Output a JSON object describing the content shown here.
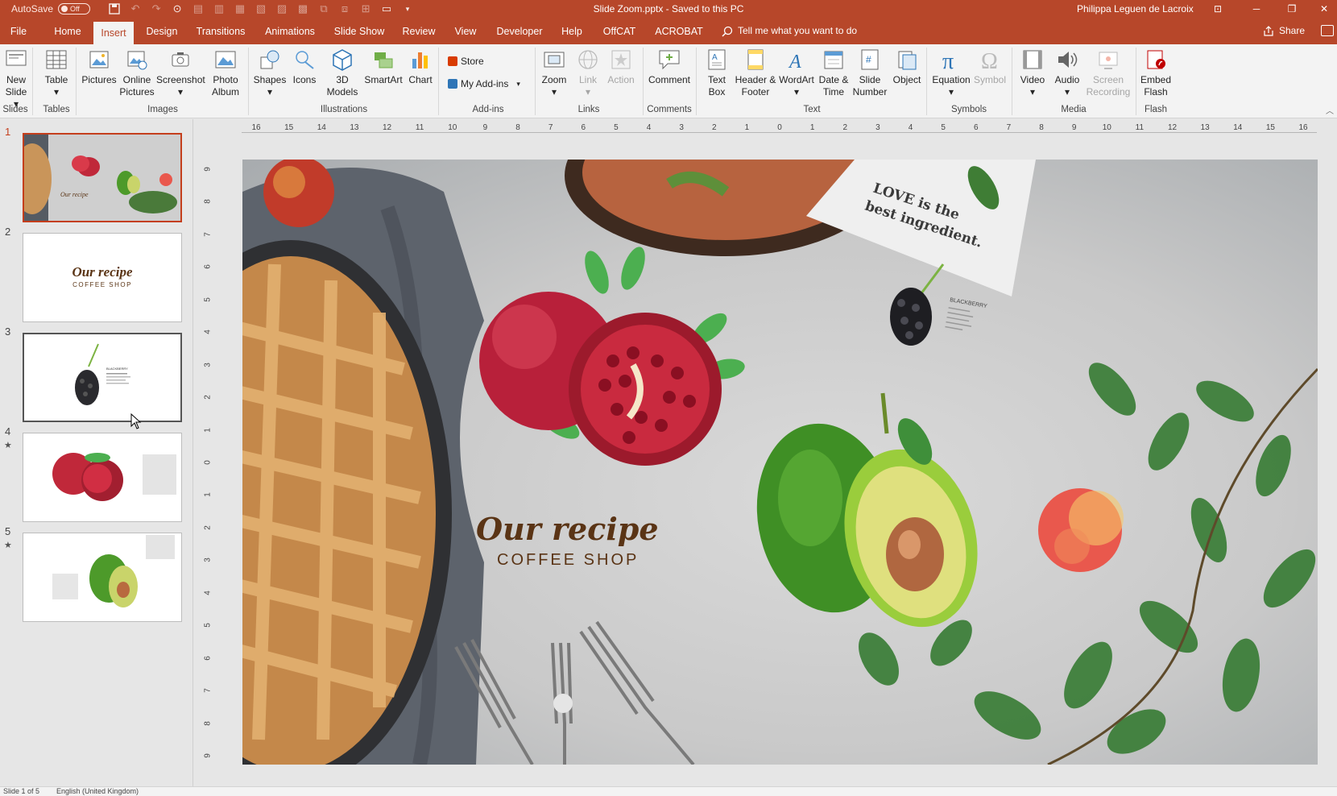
{
  "titlebar": {
    "autosave_label": "AutoSave",
    "autosave_state": "Off",
    "doc_title": "Slide Zoom.pptx  -  Saved to this PC",
    "user": "Philippa Leguen de Lacroix"
  },
  "menu": {
    "tabs": [
      "File",
      "Home",
      "Insert",
      "Design",
      "Transitions",
      "Animations",
      "Slide Show",
      "Review",
      "View",
      "Developer",
      "Help",
      "OffCAT",
      "ACROBAT"
    ],
    "active_tab": "Insert",
    "tell_me": "Tell me what you want to do",
    "share": "Share"
  },
  "ribbon": {
    "slides": {
      "new_slide": "New Slide",
      "group": "Slides"
    },
    "tables": {
      "table": "Table",
      "group": "Tables"
    },
    "images": {
      "pictures": "Pictures",
      "online_pictures": "Online Pictures",
      "screenshot": "Screenshot",
      "photo_album": "Photo Album",
      "group": "Images"
    },
    "illustrations": {
      "shapes": "Shapes",
      "icons": "Icons",
      "models_3d": "3D Models",
      "smartart": "SmartArt",
      "chart": "Chart",
      "group": "Illustrations"
    },
    "addins": {
      "store": "Store",
      "my_addins": "My Add-ins",
      "group": "Add-ins"
    },
    "links": {
      "zoom": "Zoom",
      "link": "Link",
      "action": "Action",
      "group": "Links"
    },
    "comments": {
      "comment": "Comment",
      "group": "Comments"
    },
    "text": {
      "text_box": "Text Box",
      "header_footer": "Header & Footer",
      "wordart": "WordArt",
      "date_time": "Date & Time",
      "slide_number": "Slide Number",
      "object": "Object",
      "group": "Text"
    },
    "symbols": {
      "equation": "Equation",
      "symbol": "Symbol",
      "group": "Symbols"
    },
    "media": {
      "video": "Video",
      "audio": "Audio",
      "screen_recording": "Screen Recording",
      "group": "Media"
    },
    "flash": {
      "embed_flash": "Embed Flash",
      "group": "Flash"
    }
  },
  "ruler": {
    "horizontal": [
      "16",
      "15",
      "14",
      "13",
      "12",
      "11",
      "10",
      "9",
      "8",
      "7",
      "6",
      "5",
      "4",
      "3",
      "2",
      "1",
      "0",
      "1",
      "2",
      "3",
      "4",
      "5",
      "6",
      "7",
      "8",
      "9",
      "10",
      "11",
      "12",
      "13",
      "14",
      "15",
      "16"
    ],
    "vertical": [
      "9",
      "8",
      "7",
      "6",
      "5",
      "4",
      "3",
      "2",
      "1",
      "0",
      "1",
      "2",
      "3",
      "4",
      "5",
      "6",
      "7",
      "8",
      "9"
    ]
  },
  "thumbnails": [
    {
      "num": "1",
      "star": ""
    },
    {
      "num": "2",
      "star": ""
    },
    {
      "num": "3",
      "star": ""
    },
    {
      "num": "4",
      "star": "★"
    },
    {
      "num": "5",
      "star": "★"
    }
  ],
  "thumb_texts": {
    "recipe": "Our recipe",
    "shop": "COFFEE SHOP",
    "blackberry": "BLACKBERRY"
  },
  "slide": {
    "title": "Our recipe",
    "subtitle": "COFFEE SHOP",
    "napkin_text_line1": "LOVE is the",
    "napkin_text_line2": "best ingredient.",
    "blackberry_label": "BLACKBERRY"
  },
  "colors": {
    "accent": "#b7472a",
    "title_brown": "#5a3415"
  },
  "status": {
    "slide_info": "Slide 1 of 5",
    "language": "English (United Kingdom)"
  }
}
